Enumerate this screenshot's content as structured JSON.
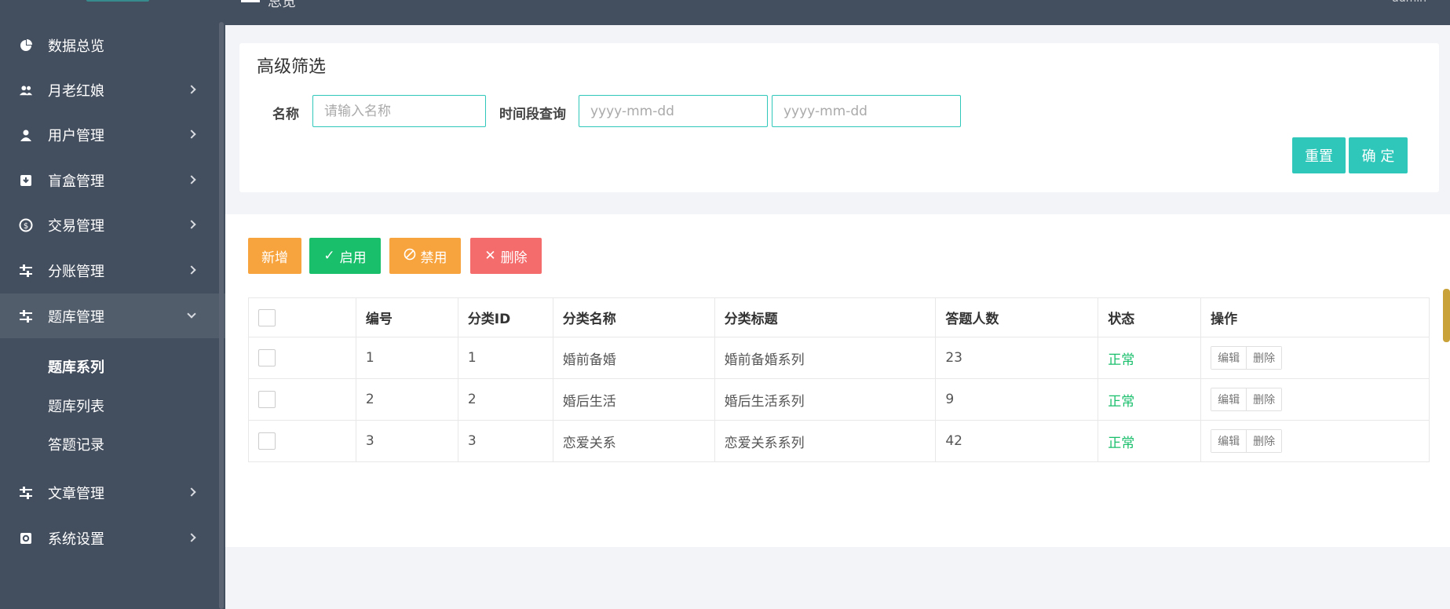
{
  "header": {
    "title": "总览",
    "user": "admin"
  },
  "sidebar": {
    "items": [
      {
        "label": "数据总览",
        "icon": "pie-chart-icon",
        "has_children": false
      },
      {
        "label": "月老红娘",
        "icon": "users-icon",
        "has_children": true
      },
      {
        "label": "用户管理",
        "icon": "user-icon",
        "has_children": true
      },
      {
        "label": "盲盒管理",
        "icon": "box-icon",
        "has_children": true
      },
      {
        "label": "交易管理",
        "icon": "coin-icon",
        "has_children": true
      },
      {
        "label": "分账管理",
        "icon": "sliders-icon",
        "has_children": true
      },
      {
        "label": "题库管理",
        "icon": "sliders-icon",
        "has_children": true,
        "expanded": true
      },
      {
        "label": "文章管理",
        "icon": "sliders-icon",
        "has_children": true
      },
      {
        "label": "系统设置",
        "icon": "settings-icon",
        "has_children": true
      }
    ],
    "sub_items": [
      "题库系列",
      "题库列表",
      "答题记录"
    ]
  },
  "filter": {
    "title": "高级筛选",
    "name_label": "名称",
    "name_placeholder": "请输入名称",
    "period_label": "时间段查询",
    "start_placeholder": "yyyy-mm-dd",
    "end_placeholder": "yyyy-mm-dd",
    "reset_label": "重置",
    "confirm_label": "确 定"
  },
  "actions": {
    "add_label": "新增",
    "enable_label": "启用",
    "disable_label": "禁用",
    "delete_label": "删除"
  },
  "table": {
    "columns": [
      "编号",
      "分类ID",
      "分类名称",
      "分类标题",
      "答题人数",
      "状态",
      "操作"
    ],
    "rows": [
      {
        "id": "1",
        "category_id": "1",
        "name": "婚前备婚",
        "title": "婚前备婚系列",
        "count": "23",
        "status": "正常"
      },
      {
        "id": "2",
        "category_id": "2",
        "name": "婚后生活",
        "title": "婚后生活系列",
        "count": "9",
        "status": "正常"
      },
      {
        "id": "3",
        "category_id": "3",
        "name": "恋爱关系",
        "title": "恋爱关系系列",
        "count": "42",
        "status": "正常"
      }
    ],
    "edit_label": "编辑",
    "delete_label": "删除"
  },
  "colors": {
    "accent": "#2ec7b9",
    "sidebar": "#434e5e",
    "success": "#1abf6c",
    "warning": "#f8a43e",
    "danger": "#f56c6c"
  }
}
